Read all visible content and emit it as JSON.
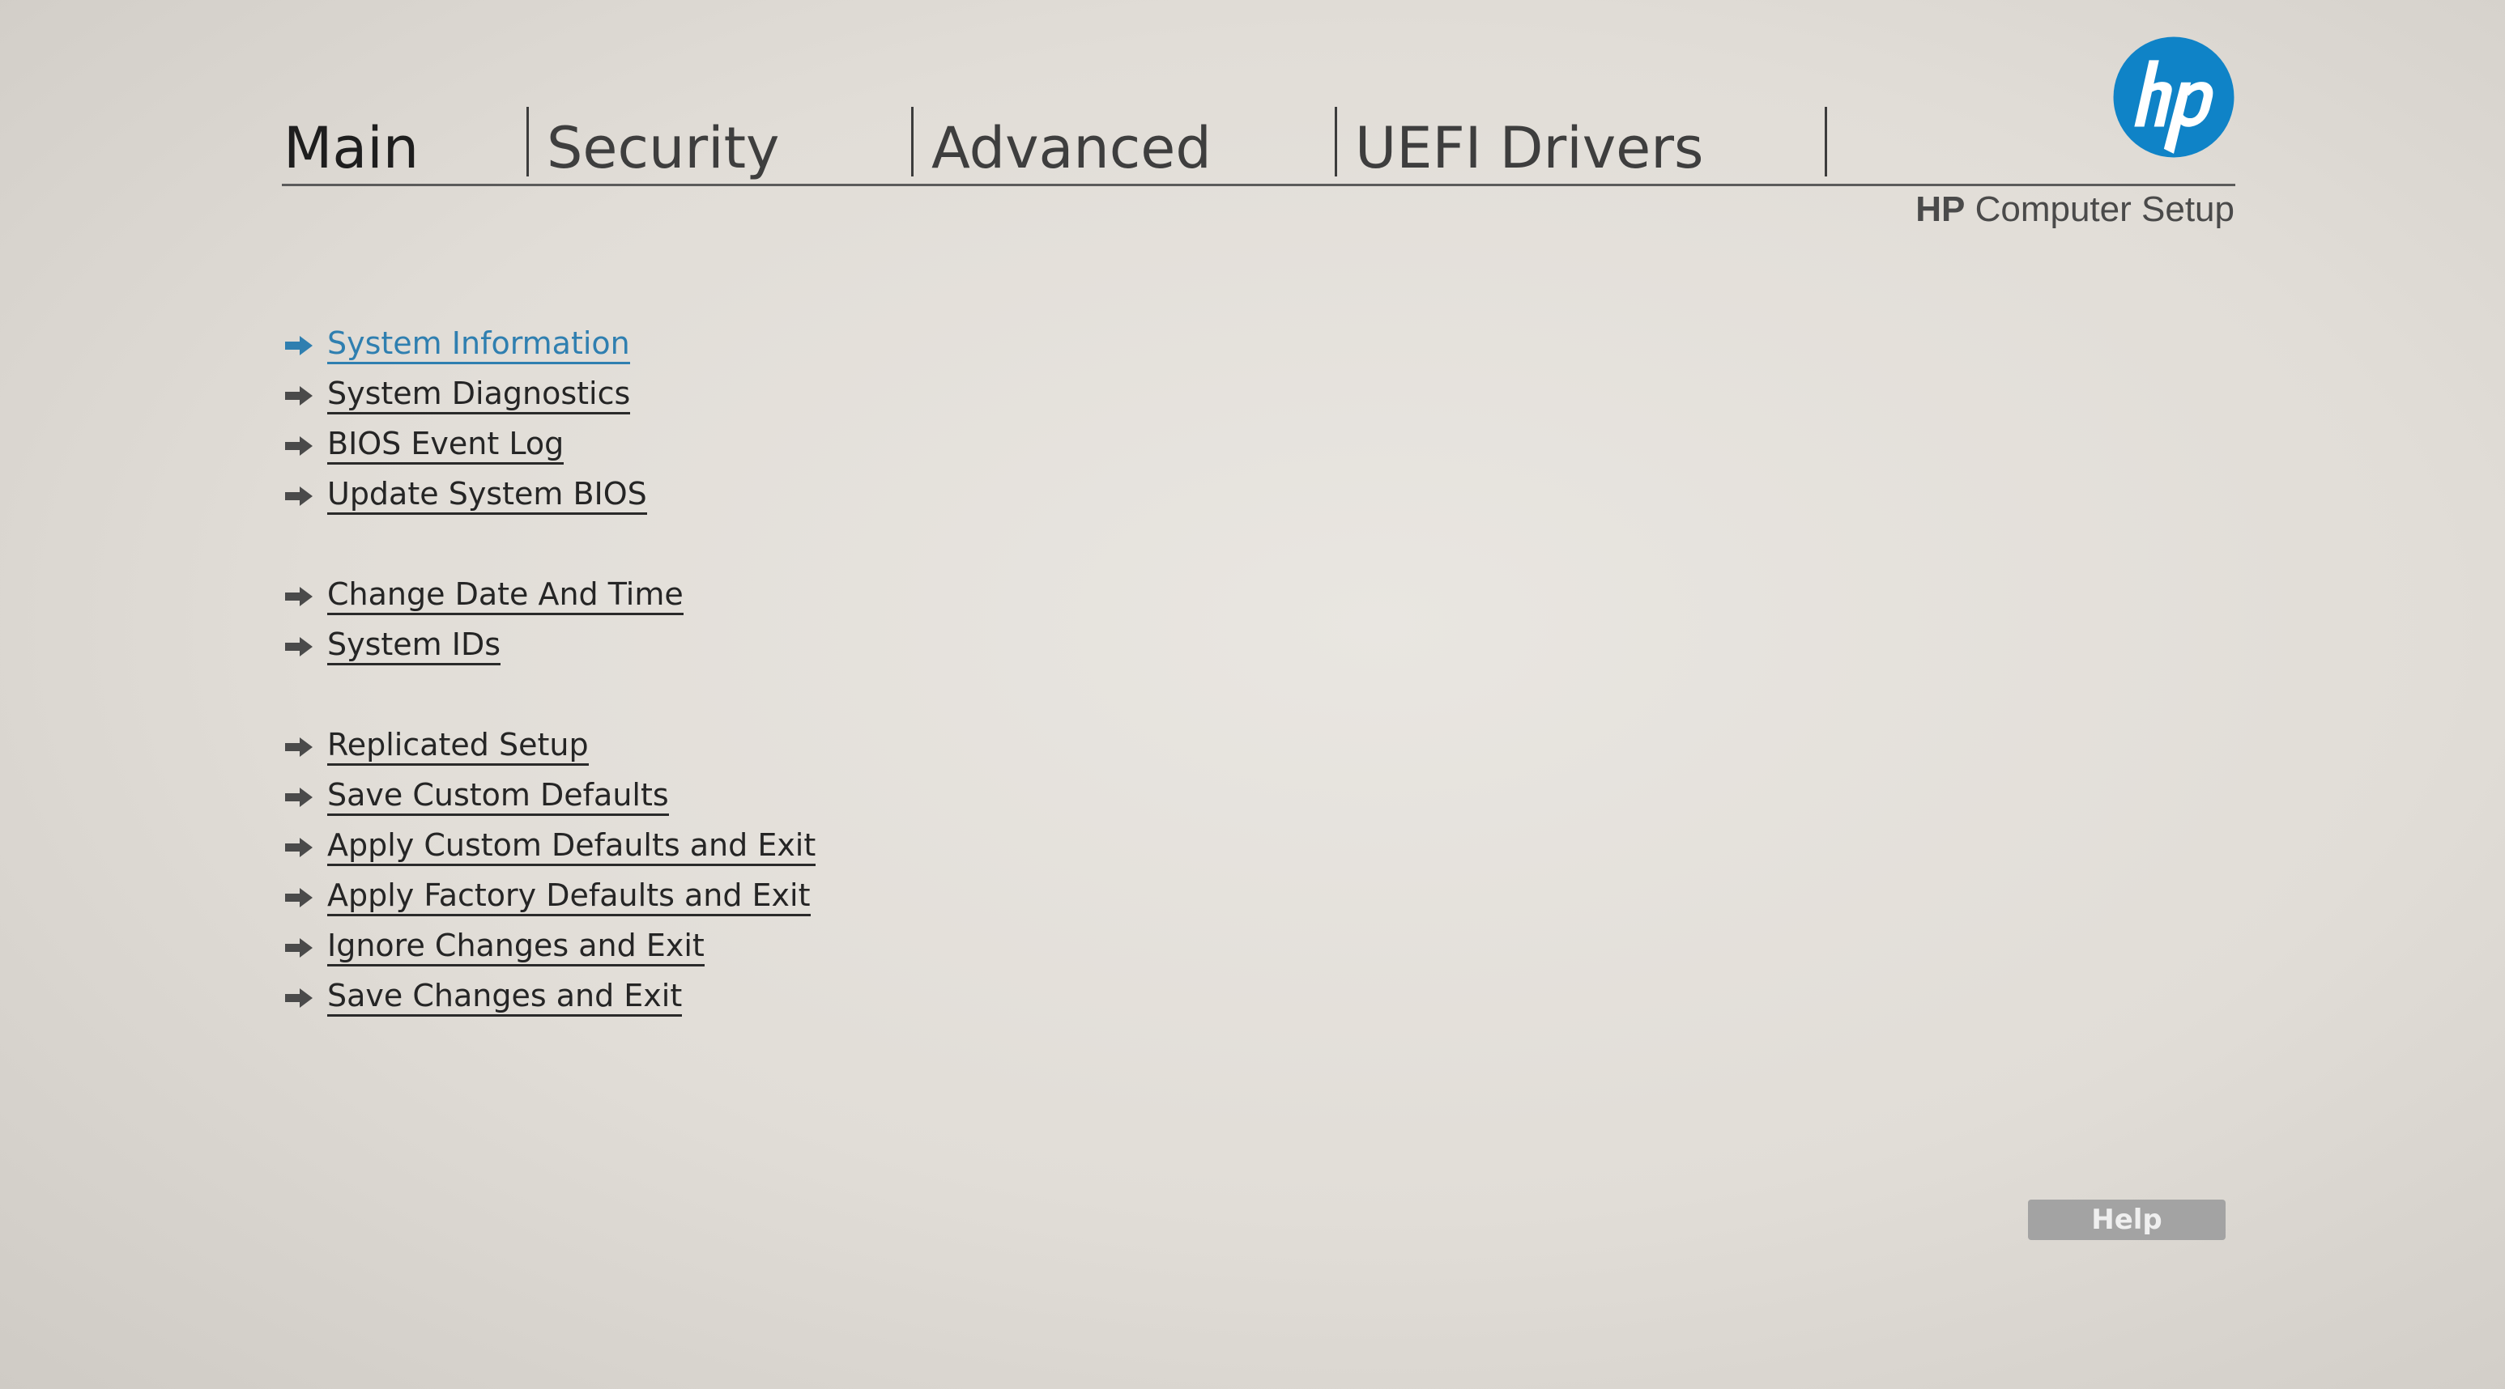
{
  "tabs": [
    {
      "label": "Main",
      "active": true
    },
    {
      "label": "Security",
      "active": false
    },
    {
      "label": "Advanced",
      "active": false
    },
    {
      "label": "UEFI Drivers",
      "active": false
    }
  ],
  "header": {
    "brand": "HP",
    "product": "Computer Setup",
    "logo_icon": "hp-logo-icon",
    "logo_color": "#0f83c7"
  },
  "menu": {
    "items": [
      {
        "label": "System Information"
      },
      {
        "label": "System Diagnostics"
      },
      {
        "label": "BIOS Event Log"
      },
      {
        "label": "Update System BIOS"
      },
      {
        "label": "Change Date And Time"
      },
      {
        "label": "System IDs"
      },
      {
        "label": "Replicated Setup"
      },
      {
        "label": "Save Custom Defaults"
      },
      {
        "label": "Apply Custom Defaults and Exit"
      },
      {
        "label": "Apply Factory Defaults and Exit"
      },
      {
        "label": "Ignore Changes and Exit"
      },
      {
        "label": "Save Changes and Exit"
      }
    ],
    "selected_color": "#2f7fb0",
    "arrow_icon": "arrow-right-icon"
  },
  "help": {
    "label": "Help"
  }
}
